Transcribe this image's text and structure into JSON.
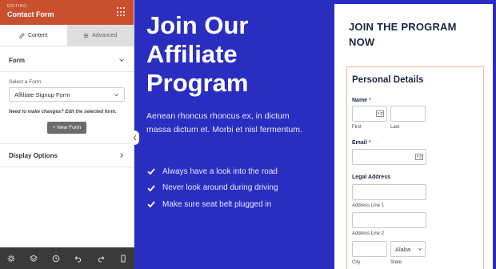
{
  "editor": {
    "editing_label": "EDITING:",
    "title": "Contact Form",
    "tabs": [
      {
        "label": "Content",
        "icon": "pencil-icon",
        "active": true
      },
      {
        "label": "Advanced",
        "icon": "sliders-icon",
        "active": false
      }
    ],
    "form_section": {
      "heading": "Form",
      "select_label": "Select a Form",
      "selected_form": "Affiliate Signup Form",
      "note": "Need to make changes? Edit the selected form.",
      "new_button": "+ New Form"
    },
    "display_section": {
      "heading": "Display Options"
    },
    "footer_icons": [
      "gear-icon",
      "layers-icon",
      "history-icon",
      "undo-icon",
      "redo-icon",
      "mobile-preview-icon"
    ]
  },
  "hero": {
    "title": "Join Our Affiliate Program",
    "description": "Aenean rhoncus rhoncus ex, in dictum massa dictum et. Morbi et nisl fermentum.",
    "bullets": [
      "Always have a look into the road",
      "Never look around during driving",
      "Make sure seat belt plugged in"
    ]
  },
  "form": {
    "title": "JOIN THE PROGRAM NOW",
    "section_title": "Personal Details",
    "name_label": "Name",
    "first_sub": "First",
    "last_sub": "Last",
    "email_label": "Email",
    "address_label": "Legal Address",
    "address1_sub": "Address Line 1",
    "address2_sub": "Address Line 2",
    "city_sub": "City",
    "state_sub": "State",
    "state_value": "Alaba",
    "required_marker": "*"
  },
  "colors": {
    "editor_header": "#c8502f",
    "hero_bg": "#2a2ec0",
    "fieldset_border": "#f4b29a",
    "footer_bg": "#3a3a3a"
  }
}
